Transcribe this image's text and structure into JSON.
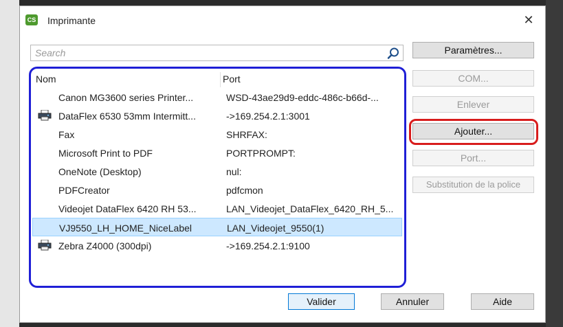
{
  "dialog": {
    "title": "Imprimante",
    "app_icon_text": "CS",
    "close_glyph": "✕"
  },
  "search": {
    "value": "",
    "placeholder": "Search",
    "icon": "search-icon"
  },
  "list": {
    "columns": {
      "name": "Nom",
      "port": "Port"
    },
    "rows": [
      {
        "name": "Canon MG3600 series Printer...",
        "port": "WSD-43ae29d9-eddc-486c-b66d-...",
        "icon": ""
      },
      {
        "name": "DataFlex 6530 53mm Intermitt...",
        "port": "->169.254.2.1:3001",
        "icon": "printer-icon"
      },
      {
        "name": "Fax",
        "port": "SHRFAX:",
        "icon": ""
      },
      {
        "name": "Microsoft Print to PDF",
        "port": "PORTPROMPT:",
        "icon": ""
      },
      {
        "name": "OneNote (Desktop)",
        "port": "nul:",
        "icon": ""
      },
      {
        "name": "PDFCreator",
        "port": "pdfcmon",
        "icon": ""
      },
      {
        "name": "Videojet DataFlex 6420 RH 53...",
        "port": "LAN_Videojet_DataFlex_6420_RH_5...",
        "icon": ""
      },
      {
        "name": "VJ9550_LH_HOME_NiceLabel",
        "port": "LAN_Videojet_9550(1)",
        "icon": "",
        "selected": true
      },
      {
        "name": "Zebra Z4000 (300dpi)",
        "port": "->169.254.2.1:9100",
        "icon": "printer-icon"
      }
    ]
  },
  "side_buttons": {
    "parametres": "Paramètres...",
    "com": "COM...",
    "enlever": "Enlever",
    "ajouter": "Ajouter...",
    "port": "Port...",
    "substitution": "Substitution de la police"
  },
  "footer_buttons": {
    "valider": "Valider",
    "annuler": "Annuler",
    "aide": "Aide"
  },
  "colors": {
    "list_highlight_outline": "#1f1fd6",
    "ajouter_highlight_outline": "#d81c1c",
    "selected_row": "#cde8ff"
  }
}
